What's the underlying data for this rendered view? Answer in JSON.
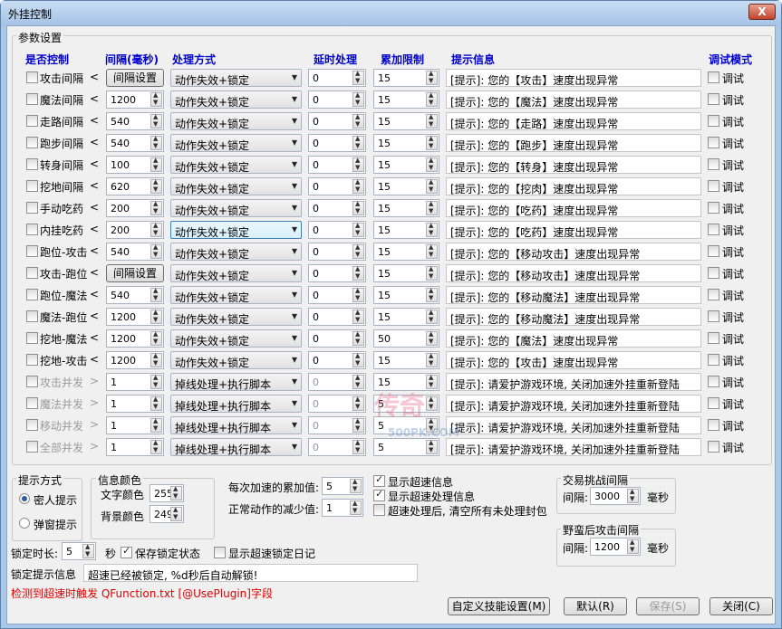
{
  "window": {
    "title": "外挂控制",
    "close_label": "X"
  },
  "params_group": "参数设置",
  "headers": {
    "enabled": "是否控制",
    "interval": "间隔(毫秒)",
    "method": "处理方式",
    "delay": "延时处理",
    "accumulate": "累加限制",
    "message": "提示信息",
    "debug": "调试模式"
  },
  "rows": [
    {
      "label": "攻击间隔",
      "lt": "<",
      "interval": "间隔设置",
      "interval_is_button": true,
      "method": "动作失效+锁定",
      "delay": "0",
      "acc": "15",
      "msg": "[提示]: 您的【攻击】速度出现异常",
      "debug": "调试",
      "disabled": false,
      "highlight": false
    },
    {
      "label": "魔法间隔",
      "lt": "<",
      "interval": "1200",
      "interval_is_button": false,
      "method": "动作失效+锁定",
      "delay": "0",
      "acc": "15",
      "msg": "[提示]: 您的【魔法】速度出现异常",
      "debug": "调试",
      "disabled": false,
      "highlight": false
    },
    {
      "label": "走路间隔",
      "lt": "<",
      "interval": "540",
      "interval_is_button": false,
      "method": "动作失效+锁定",
      "delay": "0",
      "acc": "15",
      "msg": "[提示]: 您的【走路】速度出现异常",
      "debug": "调试",
      "disabled": false,
      "highlight": false
    },
    {
      "label": "跑步间隔",
      "lt": "<",
      "interval": "540",
      "interval_is_button": false,
      "method": "动作失效+锁定",
      "delay": "0",
      "acc": "15",
      "msg": "[提示]: 您的【跑步】速度出现异常",
      "debug": "调试",
      "disabled": false,
      "highlight": false
    },
    {
      "label": "转身间隔",
      "lt": "<",
      "interval": "100",
      "interval_is_button": false,
      "method": "动作失效+锁定",
      "delay": "0",
      "acc": "15",
      "msg": "[提示]: 您的【转身】速度出现异常",
      "debug": "调试",
      "disabled": false,
      "highlight": false
    },
    {
      "label": "挖地间隔",
      "lt": "<",
      "interval": "620",
      "interval_is_button": false,
      "method": "动作失效+锁定",
      "delay": "0",
      "acc": "15",
      "msg": "[提示]: 您的【挖肉】速度出现异常",
      "debug": "调试",
      "disabled": false,
      "highlight": false
    },
    {
      "label": "手动吃药",
      "lt": "<",
      "interval": "200",
      "interval_is_button": false,
      "method": "动作失效+锁定",
      "delay": "0",
      "acc": "15",
      "msg": "[提示]: 您的【吃药】速度出现异常",
      "debug": "调试",
      "disabled": false,
      "highlight": false
    },
    {
      "label": "内挂吃药",
      "lt": "<",
      "interval": "200",
      "interval_is_button": false,
      "method": "动作失效+锁定",
      "delay": "0",
      "acc": "15",
      "msg": "[提示]: 您的【吃药】速度出现异常",
      "debug": "调试",
      "disabled": false,
      "highlight": true
    },
    {
      "label": "跑位-攻击",
      "lt": "<",
      "interval": "540",
      "interval_is_button": false,
      "method": "动作失效+锁定",
      "delay": "0",
      "acc": "15",
      "msg": "[提示]: 您的【移动攻击】速度出现异常",
      "debug": "调试",
      "disabled": false,
      "highlight": false
    },
    {
      "label": "攻击-跑位",
      "lt": "<",
      "interval": "间隔设置",
      "interval_is_button": true,
      "method": "动作失效+锁定",
      "delay": "0",
      "acc": "15",
      "msg": "[提示]: 您的【移动攻击】速度出现异常",
      "debug": "调试",
      "disabled": false,
      "highlight": false
    },
    {
      "label": "跑位-魔法",
      "lt": "<",
      "interval": "540",
      "interval_is_button": false,
      "method": "动作失效+锁定",
      "delay": "0",
      "acc": "15",
      "msg": "[提示]: 您的【移动魔法】速度出现异常",
      "debug": "调试",
      "disabled": false,
      "highlight": false
    },
    {
      "label": "魔法-跑位",
      "lt": "<",
      "interval": "1200",
      "interval_is_button": false,
      "method": "动作失效+锁定",
      "delay": "0",
      "acc": "15",
      "msg": "[提示]: 您的【移动魔法】速度出现异常",
      "debug": "调试",
      "disabled": false,
      "highlight": false
    },
    {
      "label": "挖地-魔法",
      "lt": "<",
      "interval": "1200",
      "interval_is_button": false,
      "method": "动作失效+锁定",
      "delay": "0",
      "acc": "50",
      "msg": "[提示]: 您的【魔法】速度出现异常",
      "debug": "调试",
      "disabled": false,
      "highlight": false
    },
    {
      "label": "挖地-攻击",
      "lt": "<",
      "interval": "1200",
      "interval_is_button": false,
      "method": "动作失效+锁定",
      "delay": "0",
      "acc": "15",
      "msg": "[提示]: 您的【攻击】速度出现异常",
      "debug": "调试",
      "disabled": false,
      "highlight": false
    },
    {
      "label": "攻击并发",
      "lt": ">",
      "interval": "1",
      "interval_is_button": false,
      "method": "掉线处理+执行脚本",
      "delay": "0",
      "acc": "15",
      "msg": "[提示]: 请爱护游戏环境, 关闭加速外挂重新登陆",
      "debug": "调试",
      "disabled": true,
      "highlight": false
    },
    {
      "label": "魔法并发",
      "lt": ">",
      "interval": "1",
      "interval_is_button": false,
      "method": "掉线处理+执行脚本",
      "delay": "0",
      "acc": "5",
      "msg": "[提示]: 请爱护游戏环境, 关闭加速外挂重新登陆",
      "debug": "调试",
      "disabled": true,
      "highlight": false
    },
    {
      "label": "移动并发",
      "lt": ">",
      "interval": "1",
      "interval_is_button": false,
      "method": "掉线处理+执行脚本",
      "delay": "0",
      "acc": "5",
      "msg": "[提示]: 请爱护游戏环境, 关闭加速外挂重新登陆",
      "debug": "调试",
      "disabled": true,
      "highlight": false
    },
    {
      "label": "全部并发",
      "lt": ">",
      "interval": "1",
      "interval_is_button": false,
      "method": "掉线处理+执行脚本",
      "delay": "0",
      "acc": "5",
      "msg": "[提示]: 请爱护游戏环境, 关闭加速外挂重新登陆",
      "debug": "调试",
      "disabled": true,
      "highlight": false
    }
  ],
  "prompt_mode": {
    "group": "提示方式",
    "options": [
      "密人提示",
      "弹窗提示"
    ],
    "selected": 0
  },
  "info_color": {
    "group": "信息颜色",
    "text_label": "文字颜色",
    "text_value": "255",
    "bg_label": "背景颜色",
    "bg_value": "249"
  },
  "accel": {
    "acc_label": "每次加速的累加值:",
    "acc_value": "5",
    "dec_label": "正常动作的减少值:",
    "dec_value": "1"
  },
  "checks": {
    "show_info": "显示超速信息",
    "show_handle": "显示超速处理信息",
    "clear_after": "超速处理后, 清空所有未处理封包",
    "save_lock": "保存锁定状态",
    "show_lock_log": "显示超速锁定日记"
  },
  "trade": {
    "group": "交易挑战间隔",
    "label": "间隔:",
    "value": "3000",
    "unit": "毫秒"
  },
  "savage": {
    "group": "野蛮后攻击间隔",
    "label": "间隔:",
    "value": "1200",
    "unit": "毫秒"
  },
  "lock": {
    "duration_label": "锁定时长:",
    "duration_value": "5",
    "unit": "秒",
    "tip_label": "锁定提示信息",
    "tip_value": "超速已经被锁定, %d秒后自动解锁!"
  },
  "red_text": "检测到超速时触发 QFunction.txt [@UsePlugin]字段",
  "buttons": {
    "custom": "自定义技能设置(M)",
    "default": "默认(R)",
    "save": "保存(S)",
    "close": "关闭(C)"
  },
  "watermark": {
    "text1": "传奇",
    "text2": "500PK.COM"
  },
  "colors": {
    "header": "#0000cc",
    "red": "#e00000",
    "accent": "#2a5e9c"
  }
}
